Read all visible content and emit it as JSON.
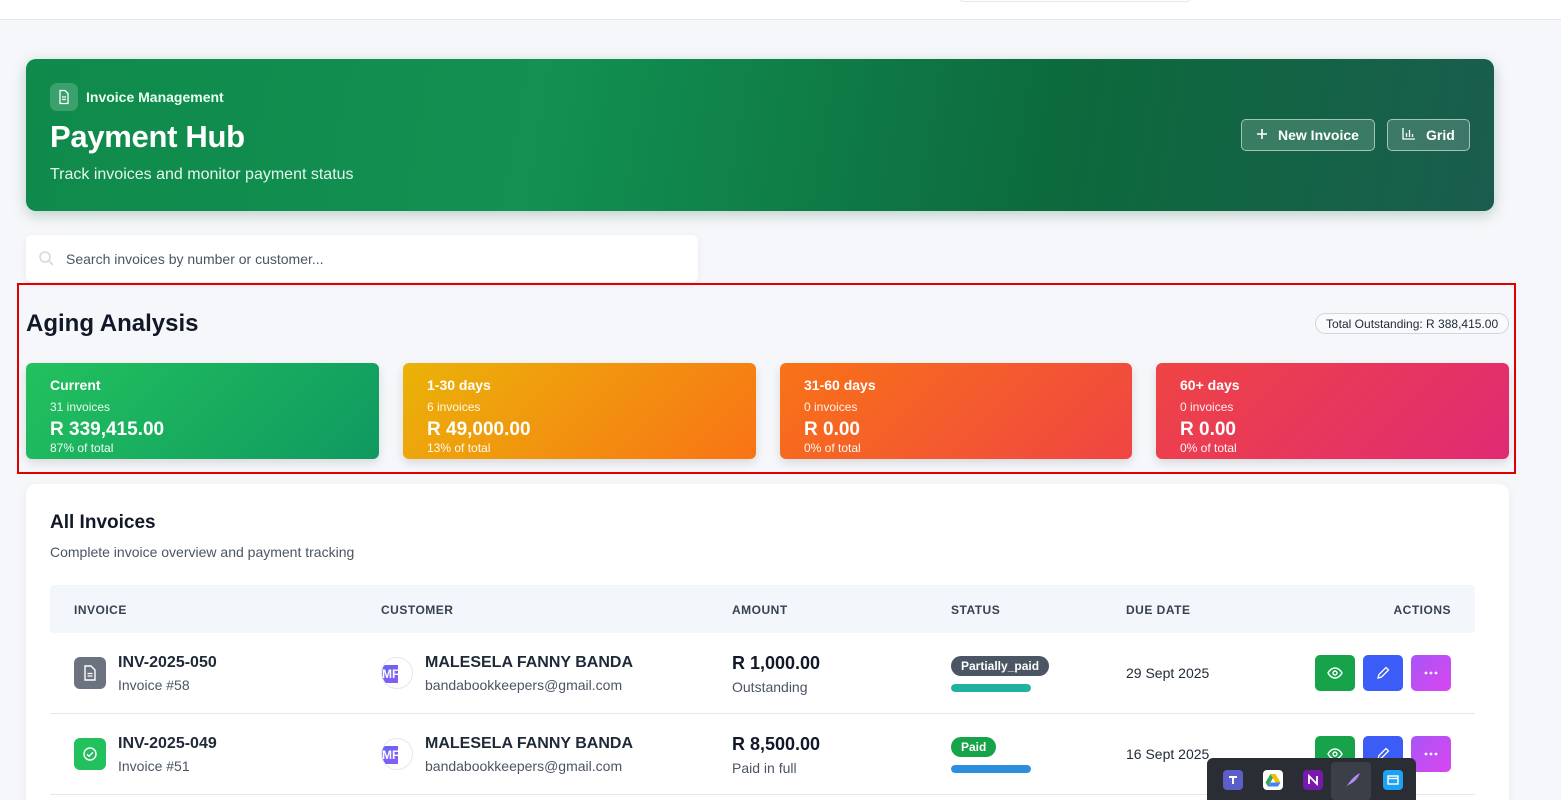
{
  "hero": {
    "eyebrow": "Invoice Management",
    "title": "Payment Hub",
    "subtitle": "Track invoices and monitor payment status",
    "new_invoice_label": "New Invoice",
    "grid_label": "Grid"
  },
  "search": {
    "placeholder": "Search invoices by number or customer..."
  },
  "aging": {
    "title": "Aging Analysis",
    "total_outstanding": "Total Outstanding: R 388,415.00",
    "buckets": [
      {
        "label": "Current",
        "count": "31 invoices",
        "amount": "R 339,415.00",
        "share": "87% of total"
      },
      {
        "label": "1-30 days",
        "count": "6 invoices",
        "amount": "R 49,000.00",
        "share": "13% of total"
      },
      {
        "label": "31-60 days",
        "count": "0 invoices",
        "amount": "R 0.00",
        "share": "0% of total"
      },
      {
        "label": "60+ days",
        "count": "0 invoices",
        "amount": "R 0.00",
        "share": "0% of total"
      }
    ]
  },
  "invoices": {
    "title": "All Invoices",
    "subtitle": "Complete invoice overview and payment tracking",
    "columns": [
      "INVOICE",
      "CUSTOMER",
      "AMOUNT",
      "STATUS",
      "DUE DATE",
      "ACTIONS"
    ],
    "rows": [
      {
        "number": "INV-2025-050",
        "ref": "Invoice #58",
        "avatar": "MF",
        "customer": "MALESELA FANNY BANDA",
        "email": "bandabookkeepers@gmail.com",
        "amount": "R 1,000.00",
        "amount_note": "Outstanding",
        "status": "Partially_paid",
        "status_color": "#4b5563",
        "progress": 1.0,
        "progress_color": "#20b2a0",
        "due": "29 Sept 2025"
      },
      {
        "number": "INV-2025-049",
        "ref": "Invoice #51",
        "avatar": "MF",
        "customer": "MALESELA FANNY BANDA",
        "email": "bandabookkeepers@gmail.com",
        "amount": "R 8,500.00",
        "amount_note": "Paid in full",
        "status": "Paid",
        "status_color": "#16a34a",
        "progress": 1.0,
        "progress_color": "#2b8fe0",
        "due": "16 Sept 2025"
      }
    ]
  },
  "taskbar": {
    "apps": [
      "teams-icon",
      "google-drive-icon",
      "onenote-icon",
      "quill-icon",
      "app-window-icon"
    ]
  }
}
